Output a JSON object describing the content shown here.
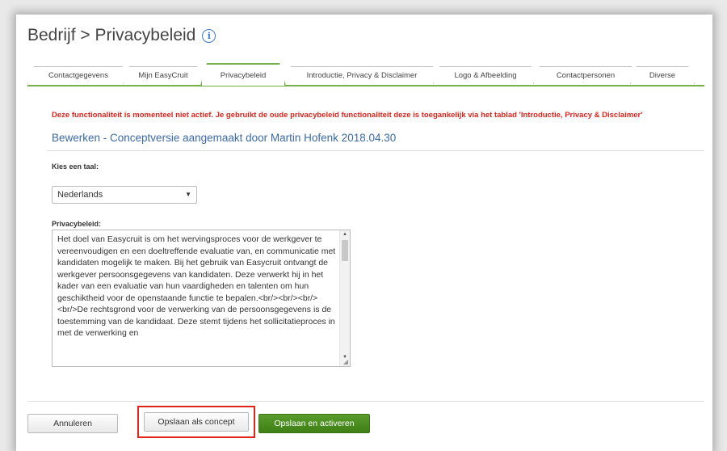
{
  "header": {
    "title": "Bedrijf > Privacybeleid",
    "info_icon": "i"
  },
  "tabs": [
    {
      "label": "Contactgegevens",
      "active": false
    },
    {
      "label": "Mijn EasyCruit",
      "active": false
    },
    {
      "label": "Privacybeleid",
      "active": true
    },
    {
      "label": "Introductie, Privacy & Disclaimer",
      "active": false
    },
    {
      "label": "Logo & Afbeelding",
      "active": false
    },
    {
      "label": "Contactpersonen",
      "active": false
    },
    {
      "label": "Diverse",
      "active": false
    }
  ],
  "warning": "Deze functionaliteit is momenteel niet actief. Je gebruikt de oude privacybeleid functionaliteit deze is toegankelijk via het tablad 'Introductie, Privacy & Disclaimer'",
  "subtitle": "Bewerken - Conceptversie aangemaakt door Martin Hofenk 2018.04.30",
  "language": {
    "label": "Kies een taal:",
    "selected": "Nederlands"
  },
  "policy": {
    "label": "Privacybeleid:",
    "text": "Het doel van Easycruit is om het wervingsproces voor de werkgever te vereenvoudigen en een doeltreffende evaluatie van, en communicatie met kandidaten mogelijk te maken. Bij het gebruik van Easycruit ontvangt de werkgever persoonsgegevens van kandidaten. Deze verwerkt hij in het kader van een evaluatie van hun vaardigheden en talenten om hun geschiktheid voor de openstaande functie te bepalen.<br/><br/><br/><br/>De rechtsgrond voor de verwerking van de persoonsgegevens is de toestemming van de kandidaat. Deze stemt tijdens het sollicitatieproces in met de verwerking en"
  },
  "buttons": {
    "cancel": "Annuleren",
    "save_concept": "Opslaan als concept",
    "save_activate": "Opslaan en activeren"
  },
  "colors": {
    "accent_green": "#74b04a",
    "warning_red": "#e2231a",
    "subtitle_blue": "#3b6aa6"
  }
}
